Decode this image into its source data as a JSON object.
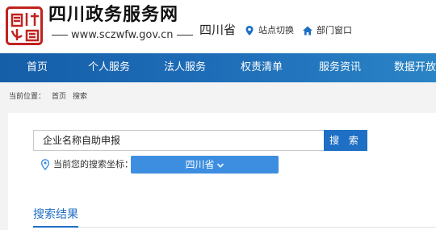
{
  "header": {
    "title": "四川政务服务网",
    "url": "www.sczwfw.gov.cn",
    "province": "四川省",
    "station_switch": "站点切换",
    "dept_window": "部门窗口"
  },
  "nav": {
    "items": [
      "首页",
      "个人服务",
      "法人服务",
      "权责清单",
      "服务资讯",
      "数据开放"
    ]
  },
  "breadcrumb": {
    "label": "当前位置：",
    "items": [
      "首页",
      "搜索"
    ]
  },
  "search": {
    "query": "企业名称自助申报",
    "button_label": "搜 索",
    "coord_label": "当前您的搜索坐标：",
    "region": "四川省"
  },
  "results": {
    "tab_label": "搜索结果"
  },
  "colors": {
    "brand_blue": "#1f6fc5",
    "nav_start": "#155ea8",
    "nav_end": "#2b84c6",
    "seal_red": "#c0221f"
  }
}
